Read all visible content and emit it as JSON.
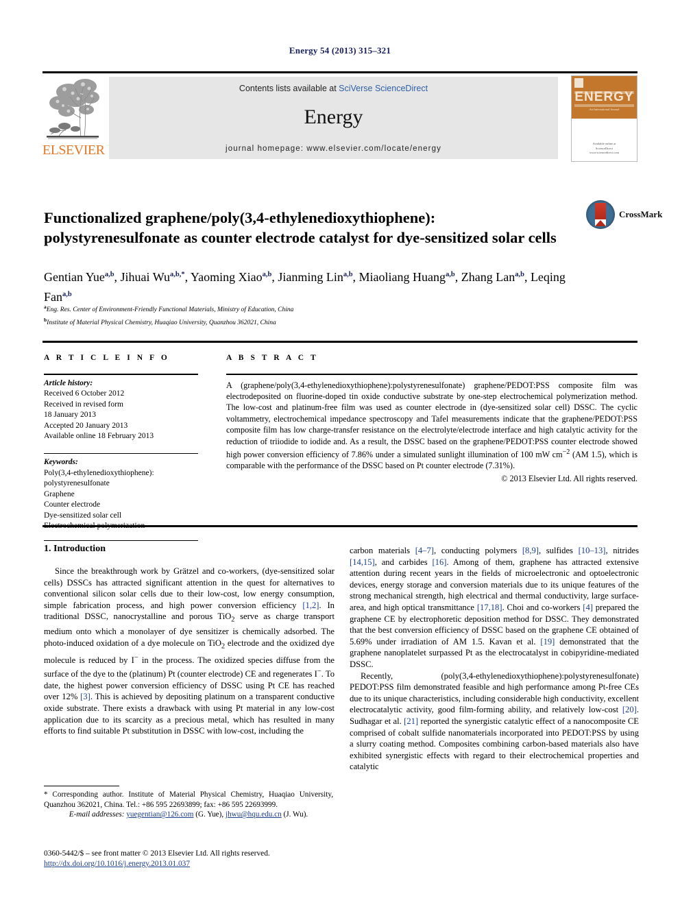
{
  "running_head": "Energy 54 (2013) 315–321",
  "masthead": {
    "contents_prefix": "Contents lists available at ",
    "contents_link": "SciVerse ScienceDirect",
    "journal_name": "Energy",
    "homepage": "journal homepage: www.elsevier.com/locate/energy",
    "publisher_wordmark": "ELSEVIER",
    "publisher_logo_name": "elsevier-tree-logo",
    "cover": {
      "title": "ENERGY",
      "subtitle": "An International Journal",
      "footer_line1": "Available online at",
      "footer_line2": "ScienceDirect",
      "footer_line3": "www.sciencedirect.com"
    }
  },
  "article": {
    "title": "Functionalized graphene/poly(3,4-ethylenedioxythiophene): polystyrenesulfonate as counter electrode catalyst for dye-sensitized solar cells",
    "crossmark_label": "CrossMark",
    "authors": [
      {
        "name": "Gentian Yue",
        "sup": "a,b",
        "sep": ", "
      },
      {
        "name": "Jihuai Wu",
        "sup": "a,b,*",
        "sep": ", "
      },
      {
        "name": "Yaoming Xiao",
        "sup": "a,b",
        "sep": ", "
      },
      {
        "name": "Jianming Lin",
        "sup": "a,b",
        "sep": ", "
      },
      {
        "name": "Miaoliang Huang",
        "sup": "a,b",
        "sep": ", "
      },
      {
        "name": "Zhang Lan",
        "sup": "a,b",
        "sep": ", "
      },
      {
        "name": "Leqing Fan",
        "sup": "a,b",
        "sep": ""
      }
    ],
    "affiliations": [
      {
        "marker": "a",
        "text": "Eng. Res. Center of Environment-Friendly Functional Materials, Ministry of Education, China"
      },
      {
        "marker": "b",
        "text": "Institute of Material Physical Chemistry, Huaqiao University, Quanzhou 362021, China"
      }
    ]
  },
  "info": {
    "heading": "A R T I C L E  I N F O",
    "history_label": "Article history:",
    "history": [
      "Received 6 October 2012",
      "Received in revised form",
      "18 January 2013",
      "Accepted 20 January 2013",
      "Available online 18 February 2013"
    ],
    "keywords_label": "Keywords:",
    "keywords": [
      "Poly(3,4-ethylenedioxythiophene):",
      "polystyrenesulfonate",
      "Graphene",
      "Counter electrode",
      "Dye-sensitized solar cell",
      "Electrochemical polymerization"
    ]
  },
  "abstract": {
    "heading": "A B S T R A C T",
    "text": "A (graphene/poly(3,4-ethylenedioxythiophene):polystyrenesulfonate) graphene/PEDOT:PSS composite film was electrodeposited on fluorine-doped tin oxide conductive substrate by one-step electrochemical polymerization method. The low-cost and platinum-free film was used as counter electrode in (dye-sensitized solar cell) DSSC. The cyclic voltammetry, electrochemical impedance spectroscopy and Tafel measurements indicate that the graphene/PEDOT:PSS composite film has low charge-transfer resistance on the electrolyte/electrode interface and high catalytic activity for the reduction of triiodide to iodide and. As a result, the DSSC based on the graphene/PEDOT:PSS counter electrode showed high power conversion efficiency of 7.86% under a simulated sunlight illumination of 100 mW cm",
    "text_sup": "−2",
    "text_tail": " (AM 1.5), which is comparable with the performance of the DSSC based on Pt counter electrode (7.31%).",
    "copyright": "© 2013 Elsevier Ltd. All rights reserved."
  },
  "body": {
    "section_number_title": "1.  Introduction",
    "left_para1_a": "Since the breakthrough work by Grätzel and co-workers, (dye-sensitized solar cells) DSSCs has attracted significant attention in the quest for alternatives to conventional silicon solar cells due to their low-cost, low energy consumption, simple fabrication process, and high power conversion efficiency ",
    "left_ref_12": "[1,2]",
    "left_para1_b": ". In traditional DSSC, nanocrystalline and porous TiO",
    "left_sub_2": "2",
    "left_para1_c": " serve as charge transport medium onto which a monolayer of dye sensitizer is chemically adsorbed. The photo-induced oxidation of a dye molecule on TiO",
    "left_para1_d": " electrode and the oxidized dye molecule is reduced by I",
    "left_sup_minus": "−",
    "left_para1_e": " in the process. The oxidized species diffuse from the surface of the dye to the (platinum) Pt (counter electrode) CE and regenerates I",
    "left_para1_f": ". To date, the highest power conversion efficiency of DSSC using Pt CE has reached over 12% ",
    "left_ref_3": "[3]",
    "left_para1_g": ". This is achieved by depositing platinum on a transparent conductive oxide substrate. There exists a drawback with using Pt material in any low-cost application due to its scarcity as a precious metal, which has resulted in many efforts to find suitable Pt substitution in DSSC with low-cost, including the",
    "right_para1_a": "carbon materials ",
    "right_ref_47": "[4–7]",
    "right_para1_b": ", conducting polymers ",
    "right_ref_89": "[8,9]",
    "right_para1_c": ", sulfides ",
    "right_ref_1013": "[10–13]",
    "right_para1_d": ", nitrides ",
    "right_ref_1415": "[14,15]",
    "right_para1_e": ", and carbides ",
    "right_ref_16": "[16]",
    "right_para1_f": ". Among of them, graphene has attracted extensive attention during recent years in the fields of microelectronic and optoelectronic devices, energy storage and conversion materials due to its unique features of the strong mechanical strength, high electrical and thermal conductivity, large surface-area, and high optical transmittance ",
    "right_ref_1718": "[17,18]",
    "right_para1_g": ". Choi and co-workers ",
    "right_ref_4": "[4]",
    "right_para1_h": " prepared the graphene CE by electrophoretic deposition method for DSSC. They demonstrated that the best conversion efficiency of DSSC based on the graphene CE obtained of 5.69% under irradiation of AM 1.5. Kavan et al. ",
    "right_ref_19": "[19]",
    "right_para1_i": " demonstrated that the graphene nanoplatelet surpassed Pt as the electrocatalyst in cobipyridine-mediated DSSC.",
    "right_para2_a": "Recently, (poly(3,4-ethylenedioxythiophene):polystyrenesulfonate) PEDOT:PSS film demonstrated feasible and high performance among Pt-free CEs due to its unique characteristics, including considerable high conductivity, excellent electrocatalytic activity, good film-forming ability, and relatively low-cost ",
    "right_ref_20": "[20]",
    "right_para2_b": ". Sudhagar et al. ",
    "right_ref_21": "[21]",
    "right_para2_c": " reported the synergistic catalytic effect of a nanocomposite CE comprised of cobalt sulfide nanomaterials incorporated into PEDOT:PSS by using a slurry coating method. Composites combining carbon-based materials also have exhibited synergistic effects with regard to their electrochemical properties and catalytic"
  },
  "footnote": {
    "corresponding": "*  Corresponding author. Institute of Material Physical Chemistry, Huaqiao University, Quanzhou 362021, China. Tel.: +86 595 22693899; fax: +86 595 22693999.",
    "email_label": "E-mail addresses:",
    "email1": "yuegentian@126.com",
    "email1_owner": "(G. Yue)",
    "email2": "jhwu@hqu.edu.cn",
    "email2_owner": "(J. Wu).",
    "issn_line": "0360-5442/$ – see front matter © 2013 Elsevier Ltd. All rights reserved.",
    "doi": "http://dx.doi.org/10.1016/j.energy.2013.01.037"
  },
  "colors": {
    "link_blue": "#1a3e8c",
    "running_head_blue": "#1a2060",
    "elsevier_orange": "#e87722",
    "banner_grey": "#e6e6e6",
    "cover_orange": "#c2772c"
  }
}
